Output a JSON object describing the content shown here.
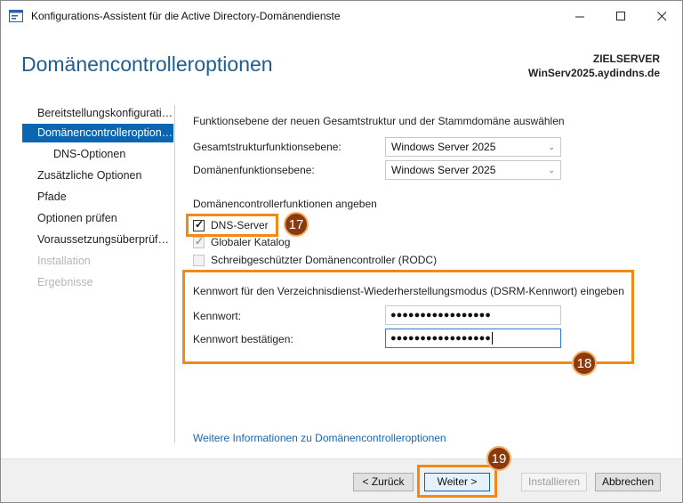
{
  "window": {
    "title": "Konfigurations-Assistent für die Active Directory-Domänendienste",
    "minimize_icon": "minimize-icon",
    "maximize_icon": "maximize-icon",
    "close_icon": "close-icon"
  },
  "header": {
    "page_title": "Domänencontrolleroptionen",
    "target_label": "ZIELSERVER",
    "target_server": "WinServ2025.aydindns.de"
  },
  "nav": {
    "items": [
      {
        "label": "Bereitstellungskonfiguration",
        "state": "normal"
      },
      {
        "label": "Domänencontrolleroptionen",
        "state": "active"
      },
      {
        "label": "DNS-Optionen",
        "state": "sub"
      },
      {
        "label": "Zusätzliche Optionen",
        "state": "normal"
      },
      {
        "label": "Pfade",
        "state": "normal"
      },
      {
        "label": "Optionen prüfen",
        "state": "normal"
      },
      {
        "label": "Voraussetzungsüberprüfung",
        "state": "normal"
      },
      {
        "label": "Installation",
        "state": "disabled"
      },
      {
        "label": "Ergebnisse",
        "state": "disabled"
      }
    ]
  },
  "main": {
    "level_heading": "Funktionsebene der neuen Gesamtstruktur und der Stammdomäne auswählen",
    "forest_level_label": "Gesamtstrukturfunktionsebene:",
    "forest_level_value": "Windows Server 2025",
    "domain_level_label": "Domänenfunktionsebene:",
    "domain_level_value": "Windows Server 2025",
    "dc_heading": "Domänencontrollerfunktionen angeben",
    "checkboxes": [
      {
        "label": "DNS-Server",
        "checked": true,
        "enabled": true
      },
      {
        "label": "Globaler Katalog",
        "checked": true,
        "enabled": false
      },
      {
        "label": "Schreibgeschützter Domänencontroller (RODC)",
        "checked": false,
        "enabled": false
      }
    ],
    "dsrm_heading": "Kennwort für den Verzeichnisdienst-Wiederherstellungsmodus (DSRM-Kennwort) eingeben",
    "password_label": "Kennwort:",
    "password_value": "●●●●●●●●●●●●●●●●●",
    "confirm_label": "Kennwort bestätigen:",
    "confirm_value": "●●●●●●●●●●●●●●●●●",
    "more_info_link": "Weitere Informationen zu Domänencontrolleroptionen"
  },
  "annotations": {
    "badge_17": "17",
    "badge_18": "18",
    "badge_19": "19",
    "highlight_color": "#f08a14",
    "badge_color": "#8a3a0c"
  },
  "footer": {
    "back_label": "< Zurück",
    "next_label": "Weiter >",
    "install_label": "Installieren",
    "cancel_label": "Abbrechen"
  },
  "colors": {
    "accent": "#0a66b3",
    "title_color": "#1f5f8f",
    "link_color": "#1a66b0"
  }
}
